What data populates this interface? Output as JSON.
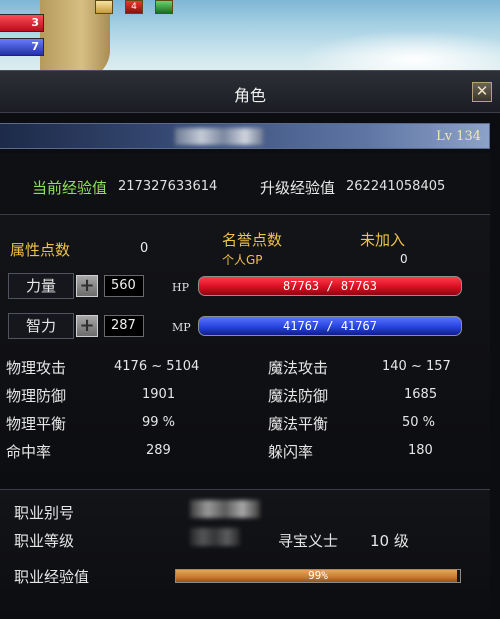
{
  "hud": {
    "hp_text": "3",
    "mp_text": "7",
    "buff_text": "4"
  },
  "window": {
    "title": "角色",
    "close_glyph": "✕",
    "level": "Lv 134"
  },
  "exp": {
    "current_label": "当前经验值",
    "current_value": "217327633614",
    "next_label": "升级经验值",
    "next_value": "262241058405"
  },
  "points": {
    "attr_label": "属性点数",
    "attr_value": "0",
    "honor_label": "名誉点数",
    "honor_value": "未加入",
    "gp_label": "个人GP",
    "gp_value": "0"
  },
  "stats": {
    "str_label": "力量",
    "str_value": "560",
    "int_label": "智力",
    "int_value": "287",
    "plus_glyph": "+",
    "hp_label": "HP",
    "hp_text": "87763 / 87763",
    "hp_fraction": 1.0,
    "mp_label": "MP",
    "mp_text": "41767 / 41767",
    "mp_fraction": 1.0
  },
  "combat": {
    "left": [
      {
        "label": "物理攻击",
        "value": "4176 ~ 5104"
      },
      {
        "label": "物理防御",
        "value": "1901"
      },
      {
        "label": "物理平衡",
        "value": "99 %"
      },
      {
        "label": "命中率",
        "value": "289"
      }
    ],
    "right": [
      {
        "label": "魔法攻击",
        "value": "140 ~ 157"
      },
      {
        "label": "魔法防御",
        "value": "1685"
      },
      {
        "label": "魔法平衡",
        "value": "50 %"
      },
      {
        "label": "躲闪率",
        "value": "180"
      }
    ]
  },
  "job": {
    "alias_label": "职业别号",
    "level_label": "职业等级",
    "class_name": "寻宝义士",
    "class_level": "10 级",
    "exp_label": "职业经验值",
    "exp_text": "99%",
    "exp_fraction": 0.99
  },
  "colors": {
    "accent_green": "#8fe05a",
    "accent_gold": "#f1c24a",
    "hp_red": "#d90f21",
    "mp_blue": "#2744e0",
    "job_exp_orange": "#c77a33"
  }
}
